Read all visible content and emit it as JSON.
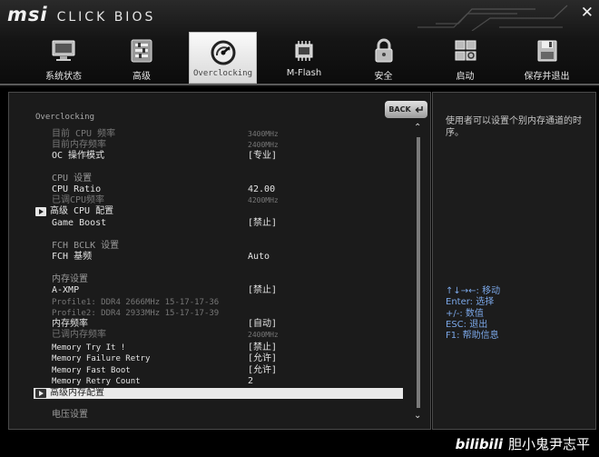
{
  "brand": {
    "msi": "msi",
    "bios": "CLICK BIOS"
  },
  "tabs": [
    {
      "label": "系统状态",
      "icon": "monitor-icon"
    },
    {
      "label": "高级",
      "icon": "settings-panel-icon"
    },
    {
      "label": "Overclocking",
      "icon": "speedometer-icon",
      "active": true
    },
    {
      "label": "M-Flash",
      "icon": "bios-chip-icon"
    },
    {
      "label": "安全",
      "icon": "lock-icon"
    },
    {
      "label": "启动",
      "icon": "boot-icon"
    },
    {
      "label": "保存并退出",
      "icon": "floppy-disk-icon"
    }
  ],
  "main": {
    "back_label": "BACK",
    "section_title": "Overclocking",
    "rows": [
      {
        "label": "目前 CPU 频率",
        "value": "3400MHz"
      },
      {
        "label": "目前内存频率",
        "value": "2400MHz"
      },
      {
        "label": "OC 操作模式",
        "value": "[专业]"
      },
      {
        "label": "CPU 设置",
        "value": ""
      },
      {
        "label": "CPU Ratio",
        "value": "42.00"
      },
      {
        "label": "已调CPU频率",
        "value": "4200MHz"
      },
      {
        "label": "高级 CPU 配置",
        "value": ""
      },
      {
        "label": "Game Boost",
        "value": "[禁止]"
      },
      {
        "label": "FCH BCLK 设置",
        "value": ""
      },
      {
        "label": "FCH 基频",
        "value": "Auto"
      },
      {
        "label": "内存设置",
        "value": ""
      },
      {
        "label": "A-XMP",
        "value": "[禁止]"
      },
      {
        "label": "Profile1: DDR4 2666MHz 15-17-17-36",
        "value": ""
      },
      {
        "label": "Profile2: DDR4 2933MHz 15-17-17-39",
        "value": ""
      },
      {
        "label": "内存频率",
        "value": "[自动]"
      },
      {
        "label": "已调内存频率",
        "value": "2400MHz"
      },
      {
        "label": "Memory Try It !",
        "value": "[禁止]"
      },
      {
        "label": "Memory Failure Retry",
        "value": "[允许]"
      },
      {
        "label": "Memory Fast Boot",
        "value": "[允许]"
      },
      {
        "label": "Memory Retry Count",
        "value": "2"
      },
      {
        "label": "高级内存配置",
        "value": ""
      },
      {
        "label": "电压设置",
        "value": ""
      }
    ]
  },
  "help": {
    "text": "使用者可以设置个别内存通道的时序。",
    "keys": [
      "↑↓→←: 移动",
      "Enter: 选择",
      "+/-: 数值",
      "ESC: 退出",
      "F1: 帮助信息"
    ]
  },
  "watermark": {
    "logo": "bilibili",
    "text": "胆小鬼尹志平"
  }
}
